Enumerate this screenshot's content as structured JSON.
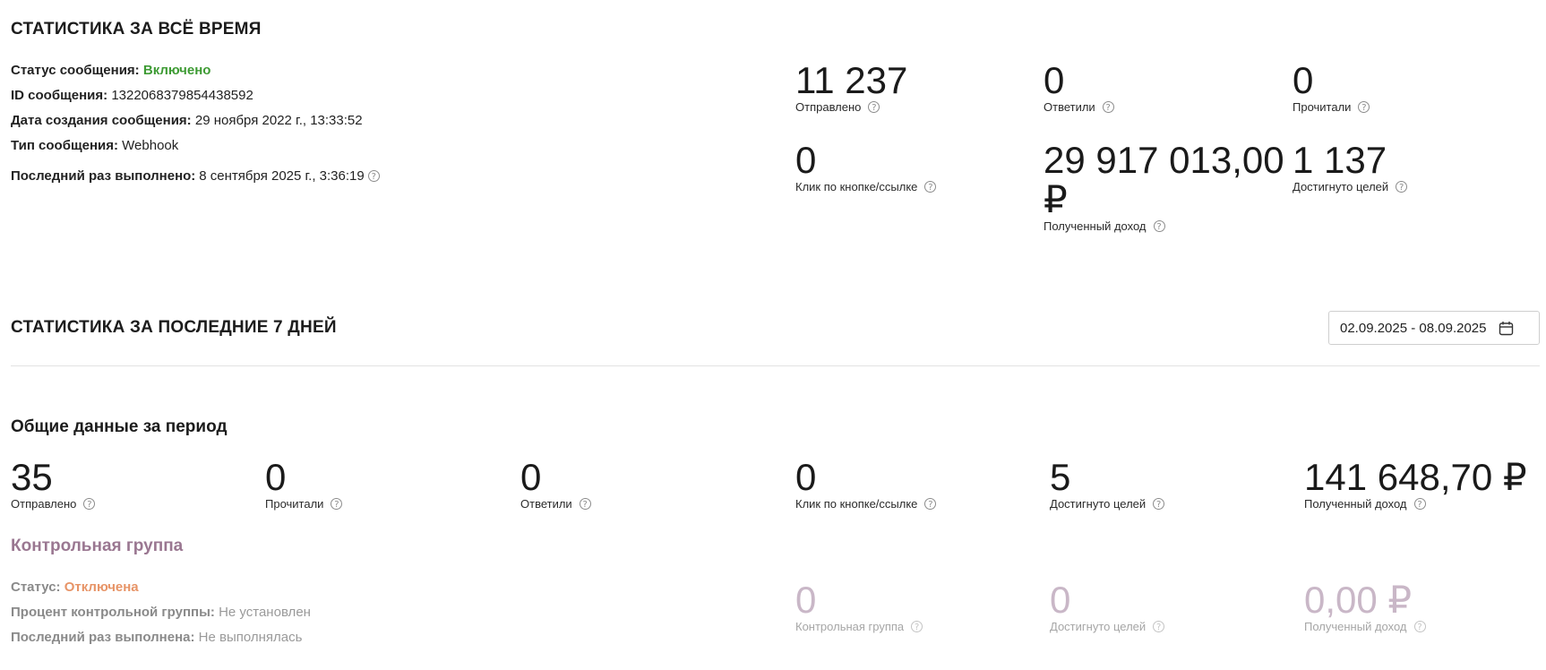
{
  "all_time": {
    "title": "СТАТИСТИКА ЗА ВСЁ ВРЕМЯ",
    "info": {
      "status_label": "Статус сообщения:",
      "status_value": "Включено",
      "id_label": "ID сообщения:",
      "id_value": "1322068379854438592",
      "created_label": "Дата создания сообщения:",
      "created_value": "29 ноября 2022 г., 13:33:52",
      "type_label": "Тип сообщения:",
      "type_value": "Webhook",
      "last_run_label": "Последний раз выполнено:",
      "last_run_value": "8 сентября 2025 г., 3:36:19"
    },
    "metrics": [
      {
        "value": "11 237",
        "label": "Отправлено"
      },
      {
        "value": "0",
        "label": "Ответили"
      },
      {
        "value": "0",
        "label": "Прочитали"
      },
      {
        "value": "0",
        "label": "Клик по кнопке/ссылке"
      },
      {
        "value_line1": "29 917 013,00",
        "value_line2": "₽",
        "label": "Полученный доход"
      },
      {
        "value": "1 137",
        "label": "Достигнуто целей"
      }
    ]
  },
  "last7": {
    "title": "СТАТИСТИКА ЗА ПОСЛЕДНИЕ 7 ДНЕЙ",
    "date_range": "02.09.2025 - 08.09.2025",
    "period_title": "Общие данные за период",
    "metrics": [
      {
        "value": "35",
        "label": "Отправлено"
      },
      {
        "value": "0",
        "label": "Прочитали"
      },
      {
        "value": "0",
        "label": "Ответили"
      },
      {
        "value": "0",
        "label": "Клик по кнопке/ссылке"
      },
      {
        "value": "5",
        "label": "Достигнуто целей"
      },
      {
        "value": "141 648,70 ₽",
        "label": "Полученный доход"
      }
    ]
  },
  "control_group": {
    "title": "Контрольная группа",
    "status_label": "Статус:",
    "status_value": "Отключена",
    "percent_label": "Процент контрольной группы:",
    "percent_value": "Не установлен",
    "last_run_label": "Последний раз выполнена:",
    "last_run_value": "Не выполнялась",
    "metrics": [
      {
        "value": "0",
        "label": "Контрольная группа"
      },
      {
        "value": "0",
        "label": "Достигнуто целей"
      },
      {
        "value": "0,00 ₽",
        "label": "Полученный доход"
      }
    ]
  },
  "colors": {
    "status_on": "#3e9b34",
    "status_off": "#e79467",
    "control_accent": "#9a7791",
    "faded_value": "#c9b7c7"
  },
  "icons": {
    "help": "question-circle-icon",
    "calendar": "calendar-icon"
  }
}
